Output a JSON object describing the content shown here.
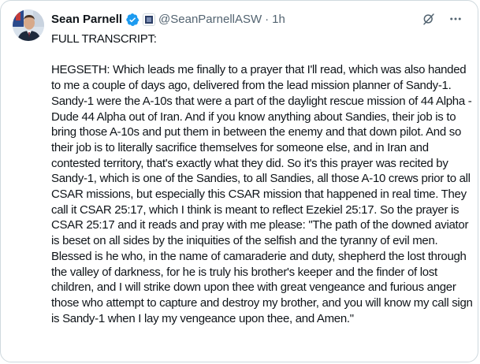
{
  "post": {
    "author_name": "Sean Parnell",
    "handle": "@SeanParnellASW",
    "separator": "·",
    "time": "1h",
    "heading": "FULL TRANSCRIPT:",
    "body": "HEGSETH: Which leads me finally to a prayer that I'll read, which was also handed to me a couple of days ago, delivered from the lead mission planner of Sandy-1. Sandy-1 were the A-10s that were a part of the daylight rescue mission of 44 Alpha - Dude 44 Alpha out of Iran. And if you know anything about Sandies, their job is to bring those A-10s and put them in between the enemy and that down pilot. And so their job is to literally sacrifice themselves for someone else, and in Iran and contested territory, that's exactly what they did. So it's this prayer was recited by Sandy-1, which is one of the Sandies, to all Sandies, all those A-10 crews prior to all CSAR missions, but especially this CSAR mission that happened in real time. They call it CSAR 25:17, which I think is meant to reflect Ezekiel 25:17. So the prayer is CSAR 25:17 and it reads and pray with me please: \"The path of the downed aviator is beset on all sides by the iniquities of the selfish and the tyranny of evil men. Blessed is he who, in the name of camaraderie and duty, shepherd the lost through the valley of darkness, for he is truly his brother's keeper and the finder of lost children, and I will strike down upon thee with great vengeance and furious anger those who attempt to capture and destroy my brother, and you will know my call sign is Sandy-1 when I lay my vengeance upon thee, and Amen.\""
  },
  "icons": {
    "verified": "verified-badge-icon",
    "affiliate": "affiliate-badge-icon",
    "grok": "grok-icon",
    "more": "more-options-icon"
  },
  "colors": {
    "text_primary": "#0f1419",
    "text_secondary": "#536471",
    "verified_blue": "#1d9bf0",
    "border": "#cfd9de"
  }
}
